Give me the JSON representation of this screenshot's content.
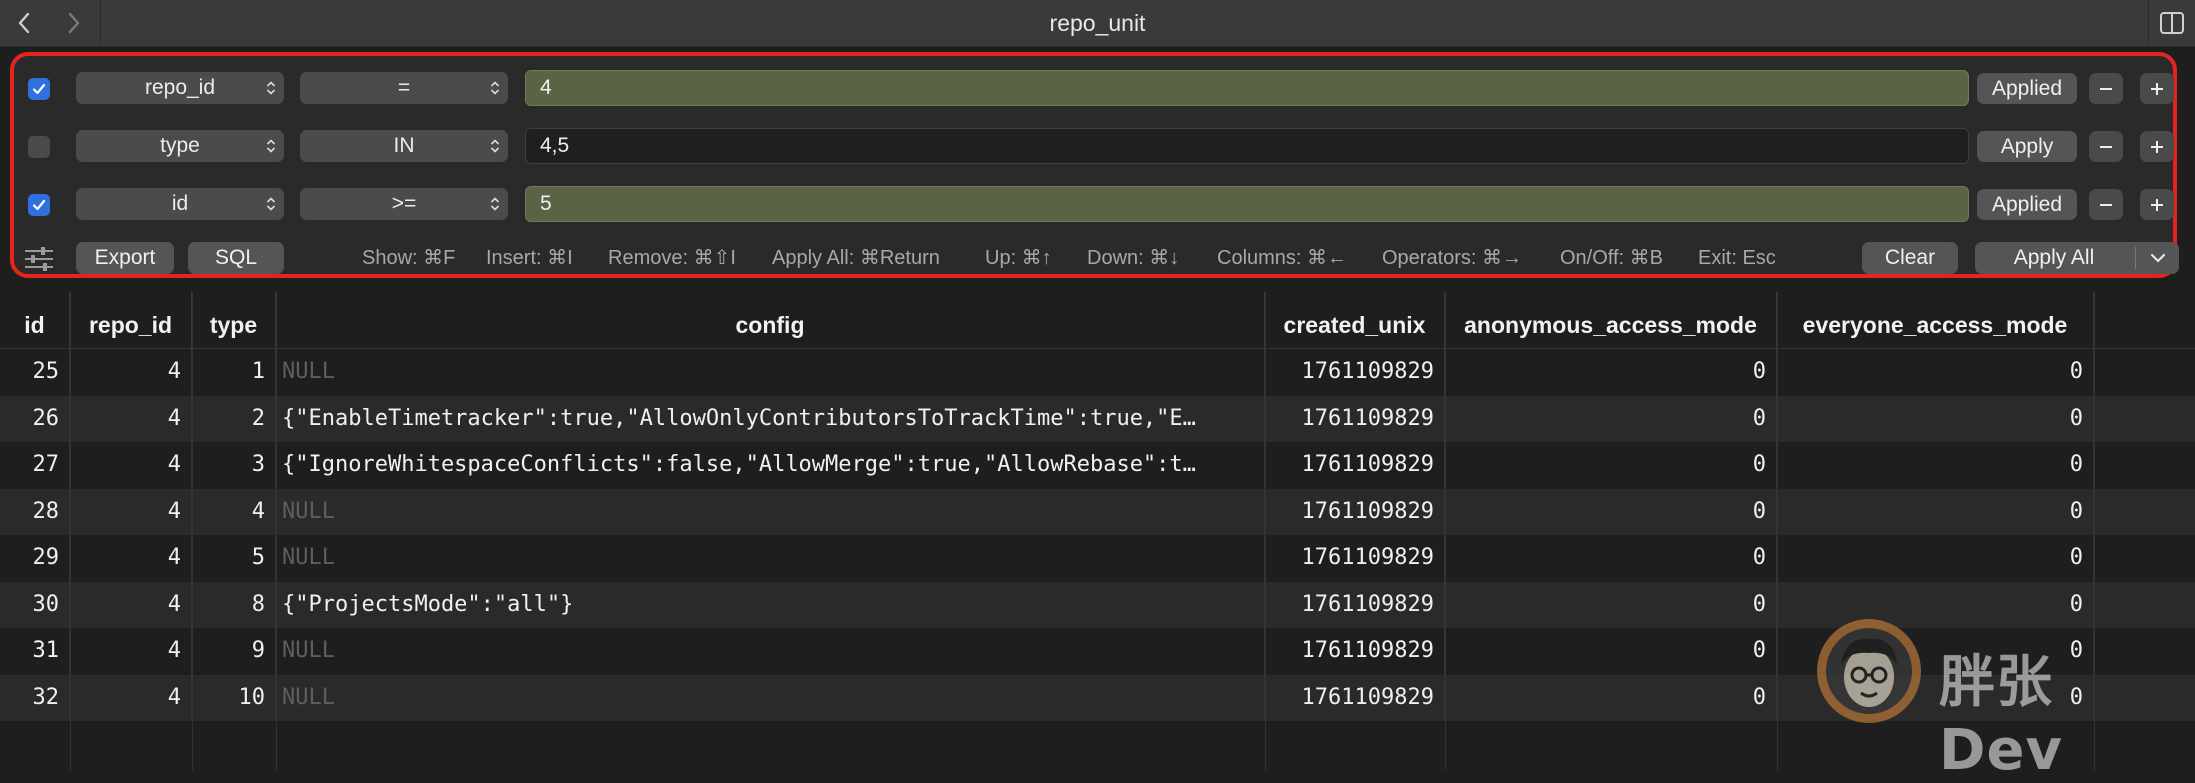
{
  "window": {
    "title": "repo_unit"
  },
  "filters": [
    {
      "enabled": true,
      "column": "repo_id",
      "operator": "=",
      "value": "4",
      "button_label": "Applied"
    },
    {
      "enabled": false,
      "column": "type",
      "operator": "IN",
      "value": "4,5",
      "button_label": "Apply"
    },
    {
      "enabled": true,
      "column": "id",
      "operator": ">=",
      "value": "5",
      "button_label": "Applied"
    }
  ],
  "toolbar": {
    "export_label": "Export",
    "sql_label": "SQL",
    "shortcuts": [
      "Show: ⌘F",
      "Insert: ⌘I",
      "Remove: ⌘⇧I",
      "Apply All: ⌘Return",
      "Up: ⌘↑",
      "Down: ⌘↓",
      "Columns: ⌘←",
      "Operators: ⌘→",
      "On/Off: ⌘B",
      "Exit: Esc"
    ],
    "clear_label": "Clear",
    "apply_all_label": "Apply All"
  },
  "table": {
    "columns": [
      "id",
      "repo_id",
      "type",
      "config",
      "created_unix",
      "anonymous_access_mode",
      "everyone_access_mode"
    ],
    "rows": [
      [
        "25",
        "4",
        "1",
        "NULL",
        "1761109829",
        "0",
        "0"
      ],
      [
        "26",
        "4",
        "2",
        "{\"EnableTimetracker\":true,\"AllowOnlyContributorsToTrackTime\":true,\"E…",
        "1761109829",
        "0",
        "0"
      ],
      [
        "27",
        "4",
        "3",
        "{\"IgnoreWhitespaceConflicts\":false,\"AllowMerge\":true,\"AllowRebase\":t…",
        "1761109829",
        "0",
        "0"
      ],
      [
        "28",
        "4",
        "4",
        "NULL",
        "1761109829",
        "0",
        "0"
      ],
      [
        "29",
        "4",
        "5",
        "NULL",
        "1761109829",
        "0",
        "0"
      ],
      [
        "30",
        "4",
        "8",
        "{\"ProjectsMode\":\"all\"}",
        "1761109829",
        "0",
        "0"
      ],
      [
        "31",
        "4",
        "9",
        "NULL",
        "1761109829",
        "0",
        "0"
      ],
      [
        "32",
        "4",
        "10",
        "NULL",
        "1761109829",
        "0",
        "0"
      ]
    ]
  },
  "watermark": {
    "text": "胖张Dev"
  },
  "colors": {
    "accent": "#2f6fe0",
    "highlight_border": "#e5231f",
    "active_value_bg": "#5a6444"
  }
}
